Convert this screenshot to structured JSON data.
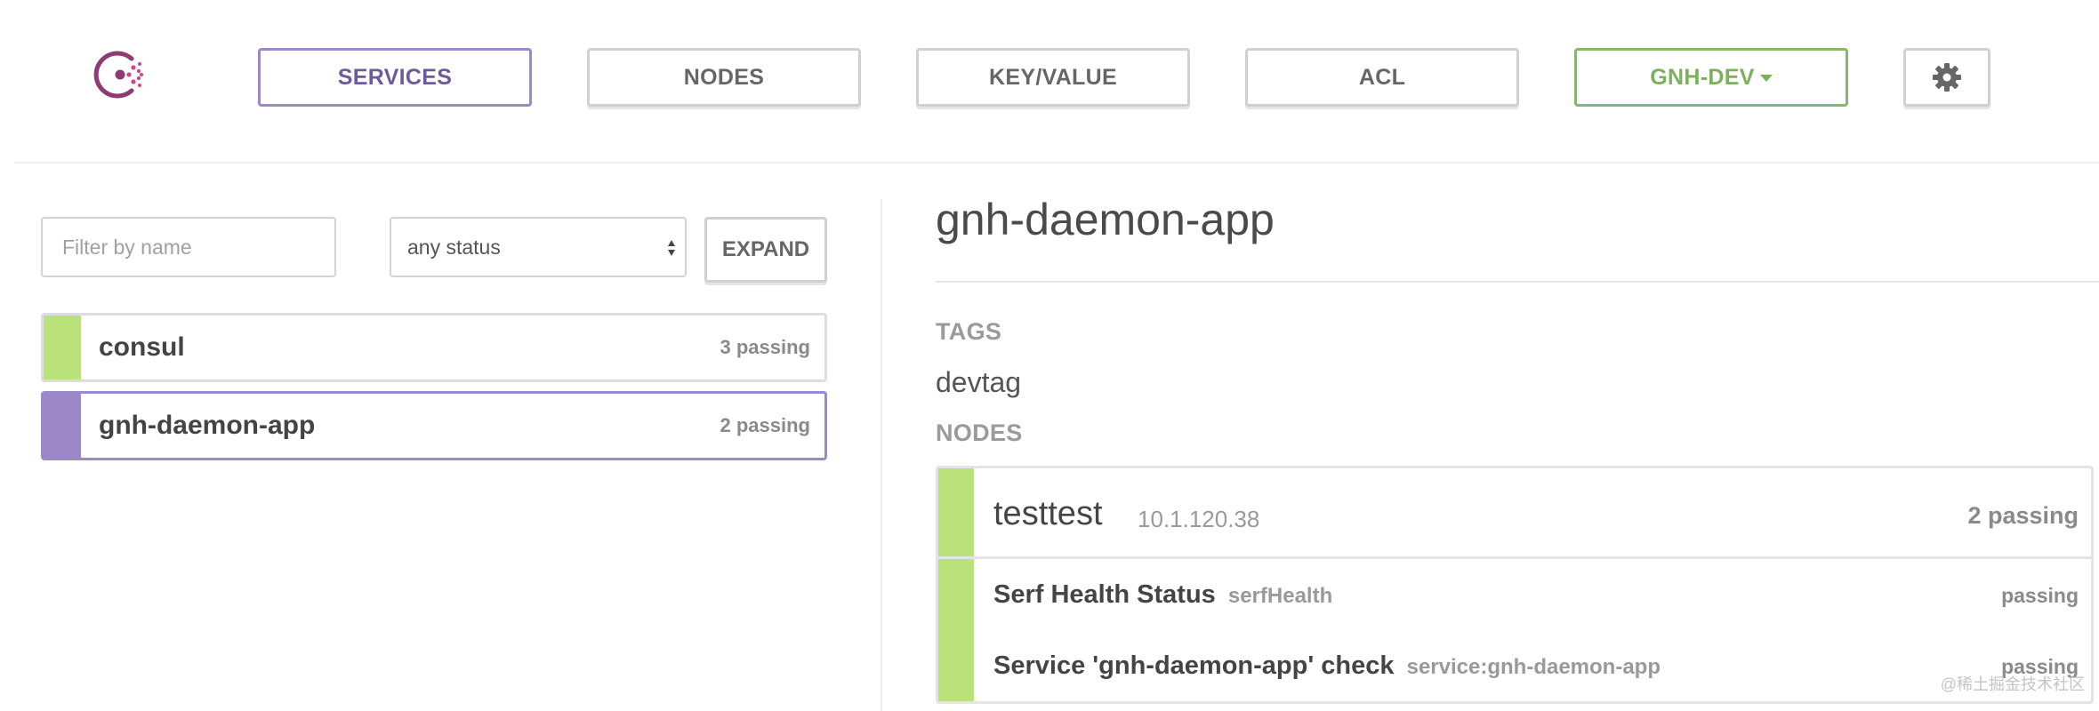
{
  "app": {
    "logo_icon": "consul-logo-icon",
    "accent_color": "#9c88c8",
    "passing_color": "#b9e27a",
    "datacenter_color": "#7bb05d"
  },
  "nav": {
    "services": "SERVICES",
    "nodes": "NODES",
    "keyvalue": "KEY/VALUE",
    "acl": "ACL",
    "datacenter": "GNH-DEV",
    "settings_icon": "gear-icon"
  },
  "filters": {
    "name_placeholder": "Filter by name",
    "status_selected": "any status",
    "expand": "EXPAND"
  },
  "services": [
    {
      "name": "consul",
      "count": "3 passing",
      "selected": false
    },
    {
      "name": "gnh-daemon-app",
      "count": "2 passing",
      "selected": true
    }
  ],
  "detail": {
    "title": "gnh-daemon-app",
    "tags_label": "TAGS",
    "tag": "devtag",
    "nodes_label": "NODES",
    "node": {
      "name": "testtest",
      "address": "10.1.120.38",
      "count": "2 passing",
      "checks": [
        {
          "name": "Serf Health Status",
          "id": "serfHealth",
          "status": "passing"
        },
        {
          "name": "Service 'gnh-daemon-app' check",
          "id": "service:gnh-daemon-app",
          "status": "passing"
        }
      ]
    }
  },
  "watermark": "@稀土掘金技术社区"
}
